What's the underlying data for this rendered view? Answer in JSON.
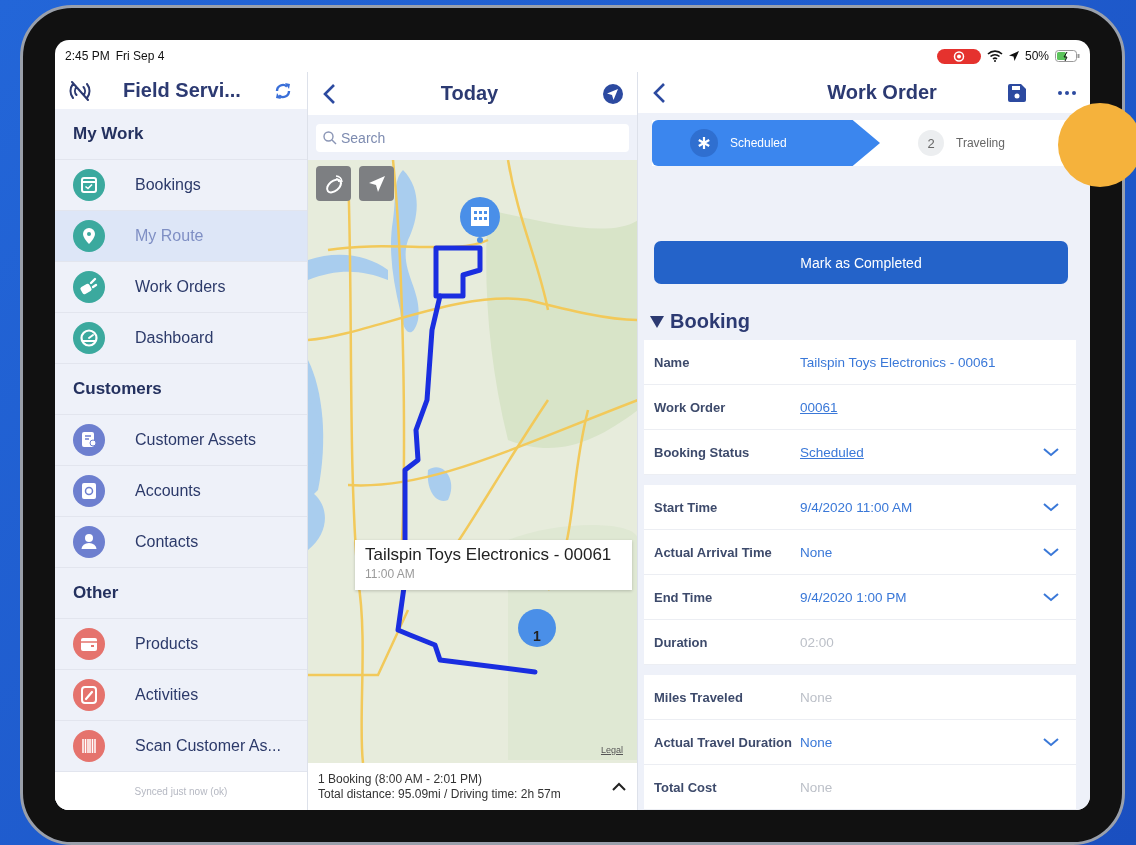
{
  "status_bar": {
    "time": "2:45 PM",
    "date": "Fri Sep 4",
    "battery": "50%"
  },
  "sidebar": {
    "title": "Field Servi...",
    "sections": [
      {
        "heading": "My Work",
        "items": [
          {
            "label": "Bookings",
            "selected": false,
            "color": "#3ba99e"
          },
          {
            "label": "My Route",
            "selected": true,
            "color": "#3ba99e"
          },
          {
            "label": "Work Orders",
            "selected": false,
            "color": "#3ba99e"
          },
          {
            "label": "Dashboard",
            "selected": false,
            "color": "#3ba99e"
          }
        ]
      },
      {
        "heading": "Customers",
        "items": [
          {
            "label": "Customer Assets",
            "selected": false,
            "color": "#6d7fcf"
          },
          {
            "label": "Accounts",
            "selected": false,
            "color": "#6d7fcf"
          },
          {
            "label": "Contacts",
            "selected": false,
            "color": "#6d7fcf"
          }
        ]
      },
      {
        "heading": "Other",
        "items": [
          {
            "label": "Products",
            "selected": false,
            "color": "#e5736d"
          },
          {
            "label": "Activities",
            "selected": false,
            "color": "#e5736d"
          },
          {
            "label": "Scan Customer As...",
            "selected": false,
            "color": "#e5736d"
          }
        ]
      }
    ],
    "footer": "Synced just now (ok)"
  },
  "route": {
    "title": "Today",
    "search": {
      "placeholder": "Search"
    },
    "callout": {
      "title": "Tailspin Toys Electronics - 00061",
      "time": "11:00 AM"
    },
    "pin": "1",
    "legal": "Legal",
    "summary": [
      "1 Booking (8:00 AM - 2:01 PM)",
      "Total distance: 95.09mi / Driving time: 2h 57m"
    ]
  },
  "work_order": {
    "title": "Work Order",
    "stages": [
      {
        "label": "Scheduled",
        "selected": true
      },
      {
        "label": "Traveling",
        "number": "2",
        "selected": false
      }
    ],
    "action": "Mark as Completed",
    "booking": {
      "title": "Booking",
      "expanded": true,
      "groups": [
        [
          {
            "label": "Name",
            "value": "Tailspin Toys Electronics - 00061",
            "kind": "value",
            "dropdown": false
          },
          {
            "label": "Work Order",
            "value": "00061",
            "kind": "link",
            "dropdown": false
          },
          {
            "label": "Booking Status",
            "value": "Scheduled",
            "kind": "link",
            "dropdown": true
          }
        ],
        [
          {
            "label": "Start Time",
            "value": "9/4/2020 11:00 AM",
            "kind": "value",
            "dropdown": true
          },
          {
            "label": "Actual Arrival Time",
            "value": "None",
            "kind": "value",
            "dropdown": true
          },
          {
            "label": "End Time",
            "value": "9/4/2020 1:00 PM",
            "kind": "value",
            "dropdown": true
          },
          {
            "label": "Duration",
            "value": "02:00",
            "kind": "empty",
            "dropdown": false
          }
        ],
        [
          {
            "label": "Miles Traveled",
            "value": "None",
            "kind": "empty",
            "dropdown": false
          },
          {
            "label": "Actual Travel Duration",
            "value": "None",
            "kind": "value",
            "dropdown": true
          },
          {
            "label": "Total Cost",
            "value": "None",
            "kind": "empty",
            "dropdown": false
          }
        ]
      ]
    }
  }
}
